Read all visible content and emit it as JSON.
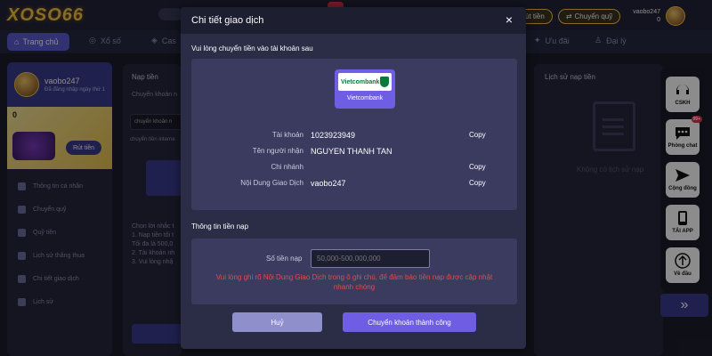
{
  "background": {
    "logo": "XOSO66",
    "top": {
      "withdraw_label": "Rút tiền",
      "transfer_label": "Chuyển quỹ",
      "username": "vaobo247",
      "balance": "0"
    },
    "nav": {
      "home": "Trang chủ",
      "lottery": "Xổ số",
      "casino": "Cas",
      "promo": "Ưu đãi",
      "agent": "Đại lý"
    },
    "profile": {
      "username": "vaobo247",
      "login_note": "Đã đăng nhập ngày thứ 1",
      "balance": "0",
      "withdraw_button": "Rút tiền"
    },
    "menu": [
      "Thông tin cá nhân",
      "Chuyển quỹ",
      "Quỹ tiền",
      "Lịch sử thắng thua",
      "Chi tiết giao dịch",
      "Lịch sử"
    ],
    "deposit_panel": {
      "title": "Nạp tiền",
      "tab": "Chuyển khoản n",
      "input_text": "chuyển khoản n",
      "note": "chuyển tiền interne",
      "instructions_title": "Chọn lời nhắc t",
      "instructions": [
        "1. Nạp tiền tối t",
        "Tối đa là 500,0",
        "2. Tài khoản nh",
        "3. Vui lòng nhậ"
      ],
      "button": "N"
    },
    "history_panel": {
      "title": "Lịch sử nạp tiền",
      "empty_text": "Không có lịch sử nạp"
    },
    "side_float": {
      "support": "CSKH",
      "chat": "Phòng chat",
      "chat_badge": "99+",
      "community": "Cộng đồng",
      "app": "TẢI APP",
      "top": "Về đầu",
      "next": "»"
    }
  },
  "modal": {
    "title": "Chi tiết giao dịch",
    "close": "×",
    "transfer_section": "Vui lòng chuyển tiền vào tài khoản sau",
    "bank": {
      "logo_text": "Vietcombank",
      "name": "Vietcombank"
    },
    "rows": [
      {
        "label": "Tài khoản",
        "value": "1023923949",
        "copy": "Copy"
      },
      {
        "label": "Tên người nhận",
        "value": "NGUYEN THANH TAN",
        "copy": ""
      },
      {
        "label": "Chi nhánh",
        "value": "",
        "copy": "Copy"
      },
      {
        "label": "Nội Dung Giao Dịch",
        "value": "vaobo247",
        "copy": "Copy"
      }
    ],
    "deposit_section": "Thông tin tiền nạp",
    "amount_label": "Số tiền nạp",
    "amount_placeholder": "50,000-500,000,000",
    "warning": "Vui lòng ghi rõ Nội Dung Giao Dịch trong ô ghi chú, để đảm bảo tiền nạp được cập nhật nhanh chóng",
    "cancel_button": "Huỷ",
    "confirm_button": "Chuyển khoản thành công"
  },
  "colors": {
    "accent": "#6f5de3",
    "warning": "#e8494a",
    "modal_bg": "#2b2c45",
    "box_bg": "#3a3b5e"
  }
}
